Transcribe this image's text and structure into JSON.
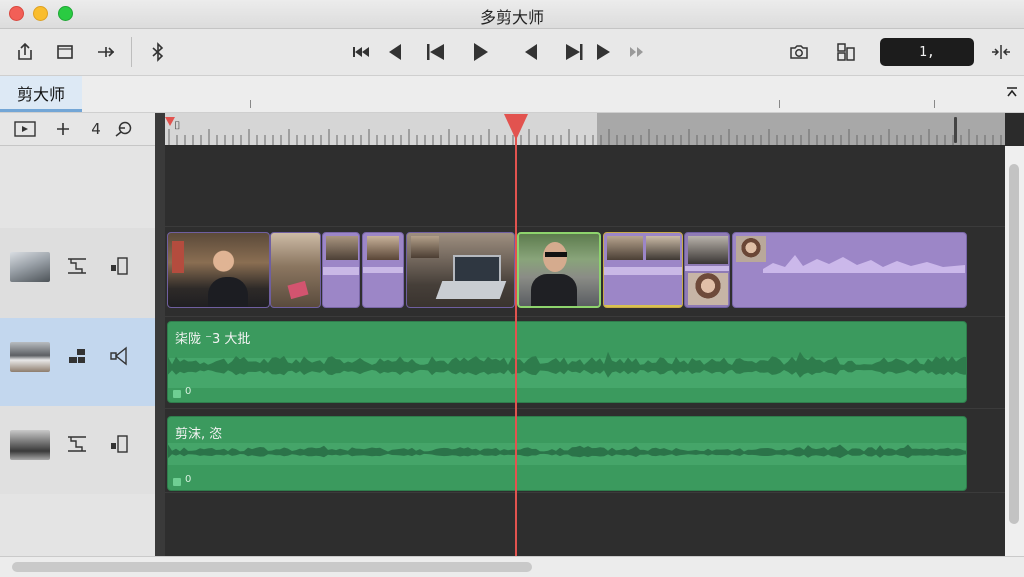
{
  "window": {
    "title": "多剪大师"
  },
  "toolbar": {
    "left_icons": [
      "share-icon",
      "crop-icon",
      "split-icon",
      "bluetooth-icon"
    ],
    "transport_icons": [
      "rewind-icon",
      "prev-frame-icon",
      "skip-start-icon",
      "play-icon",
      "step-back-icon",
      "skip-end-icon",
      "next-icon",
      "fast-forward-icon"
    ],
    "right_icons": [
      "camera-icon",
      "inspector-icon"
    ],
    "timecode": "1,",
    "fit_icon": "fit-icon"
  },
  "tabs": [
    {
      "label": "剪大师",
      "selected": true
    }
  ],
  "track_controls": {
    "zoom_value": "4"
  },
  "timeline": {
    "clips": [
      {
        "type": "video"
      },
      {
        "type": "video"
      },
      {
        "type": "purple"
      },
      {
        "type": "purple"
      },
      {
        "type": "video"
      },
      {
        "type": "video",
        "selected": true
      },
      {
        "type": "purple"
      },
      {
        "type": "video"
      },
      {
        "type": "purple"
      }
    ],
    "audio_tracks": [
      {
        "label": "柒陇 ⁻3 大批",
        "badge": "0"
      },
      {
        "label": "剪沫, 恣",
        "badge": "0"
      }
    ]
  },
  "colors": {
    "accent": "#73a6d6",
    "playhead": "#e2534f",
    "audio": "#3b9a5e",
    "video_clip": "#9c86c7",
    "selected_clip": "#8ed46d"
  }
}
